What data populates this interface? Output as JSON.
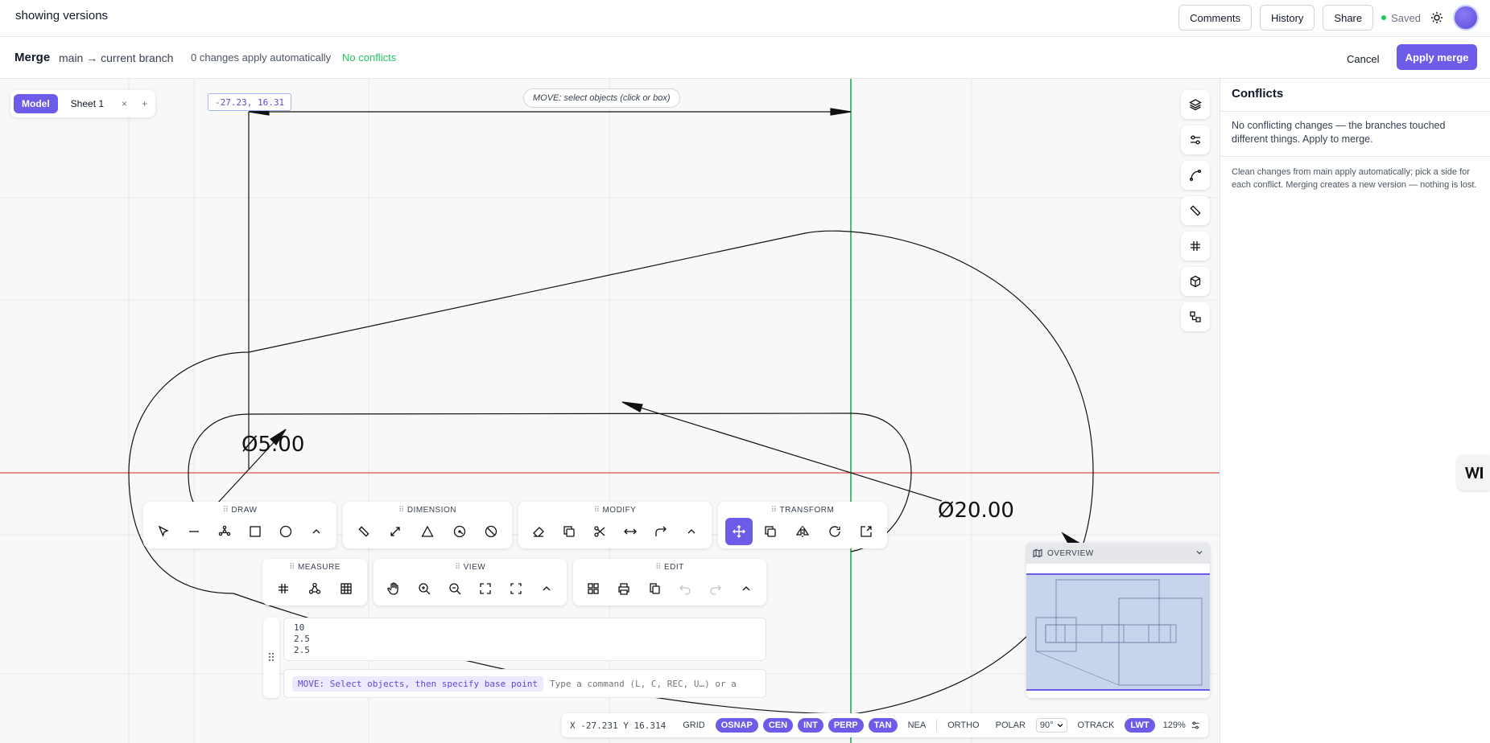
{
  "topbar": {
    "title": "showing versions",
    "comments": "Comments",
    "history": "History",
    "share": "Share",
    "saved": "Saved"
  },
  "merge": {
    "title": "Merge",
    "branch": "main → current branch",
    "changes": "0 changes apply automatically",
    "conflicts": "No conflicts",
    "cancel": "Cancel",
    "apply": "Apply merge"
  },
  "tabs": {
    "model": "Model",
    "sheet1": "Sheet 1",
    "close": "×",
    "add": "+"
  },
  "canvas": {
    "coord_tip": "-27.23, 16.31",
    "move_tip": "MOVE: select objects (click or box)",
    "dim_small": "Ø5.00",
    "dim_large": "Ø20.00"
  },
  "right_tools": [
    "layers-icon",
    "sliders-icon",
    "curve-icon",
    "ruler-icon",
    "grid-hash-icon",
    "cube-icon",
    "blocks-icon"
  ],
  "toolbars": {
    "draw": "DRAW",
    "dimension": "DIMENSION",
    "modify": "MODIFY",
    "transform": "TRANSFORM",
    "measure": "MEASURE",
    "view": "VIEW",
    "edit": "EDIT"
  },
  "command": {
    "history": [
      "10",
      "2.5",
      "2.5"
    ],
    "prompt": "MOVE: Select objects, then specify base point",
    "placeholder": "Type a command (L, C, REC, U…) or a"
  },
  "overview": {
    "title": "OVERVIEW"
  },
  "status": {
    "coords": "X -27.231  Y 16.314",
    "grid": "GRID",
    "osnap": "OSNAP",
    "cen": "CEN",
    "int": "INT",
    "perp": "PERP",
    "tan": "TAN",
    "nea": "NEA",
    "ortho": "ORTHO",
    "polar": "POLAR",
    "polar_angle": "90°",
    "otrack": "OTRACK",
    "lwt": "LWT",
    "zoom": "129%"
  },
  "panel": {
    "title": "Conflicts",
    "message": "No conflicting changes — the branches touched different things. Apply to merge.",
    "note": "Clean changes from main apply automatically; pick a side for each conflict. Merging creates a new version — nothing is lost."
  },
  "colors": {
    "accent": "#6d5ce8",
    "success": "#22c55e",
    "axis_x": "#dc2626",
    "axis_y": "#16a34a"
  }
}
